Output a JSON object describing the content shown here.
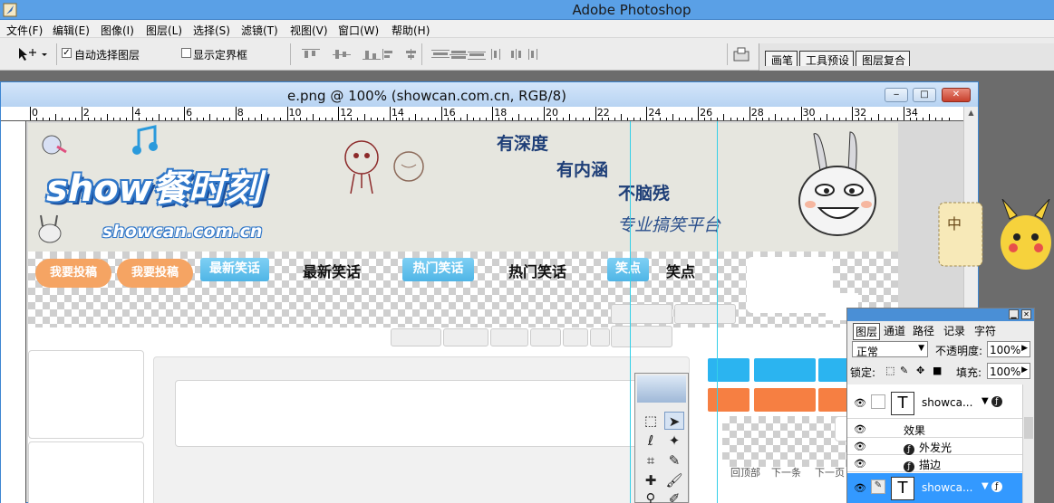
{
  "app": {
    "title": "Adobe Photoshop",
    "menus": [
      "文件(F)",
      "编辑(E)",
      "图像(I)",
      "图层(L)",
      "选择(S)",
      "滤镜(T)",
      "视图(V)",
      "窗口(W)",
      "帮助(H)"
    ]
  },
  "options": {
    "auto_select_label": "自动选择图层",
    "auto_select_checked": true,
    "show_bounds_label": "显示定界框",
    "show_bounds_checked": false
  },
  "palette_well": {
    "tabs": [
      "画笔",
      "工具预设",
      "图层复合"
    ]
  },
  "document": {
    "title": "e.png @ 100% (showcan.com.cn, RGB/8)",
    "ruler_labels": [
      "0",
      "2",
      "4",
      "6",
      "8",
      "10",
      "12",
      "14",
      "16",
      "18",
      "20",
      "22",
      "24",
      "26",
      "28",
      "30",
      "32",
      "34"
    ],
    "window_buttons": [
      "minimize",
      "restore",
      "close"
    ]
  },
  "canvas": {
    "logo_main": "show餐时刻",
    "logo_url": "showcan.com.cn",
    "slogans": [
      "有深度",
      "有内涵",
      "不脑残",
      "专业搞笑平台"
    ],
    "bubbles": [
      "我要投稿",
      "我要投稿"
    ],
    "nav_buttons": [
      "最新笑话",
      "热门笑话",
      "笑点"
    ],
    "nav_texts": [
      "最新笑话",
      "热门笑话",
      "笑点"
    ],
    "pager": [
      "回顶部",
      "下一条",
      "下一页"
    ]
  },
  "layers_panel": {
    "tabs": [
      "图层",
      "通道",
      "路径",
      "记录",
      "字符"
    ],
    "blend_mode": "正常",
    "opacity_label": "不透明度:",
    "opacity_value": "100%",
    "lock_label": "锁定:",
    "fill_label": "填充:",
    "fill_value": "100%",
    "layers": [
      {
        "name": "showca...",
        "type": "text",
        "selected": false
      },
      {
        "name": "showca...",
        "type": "text",
        "selected": true
      }
    ],
    "effects_label": "效果",
    "effects": [
      "外发光",
      "描边"
    ]
  },
  "side_widget": {
    "text": "中"
  },
  "colors": {
    "titlebar": "#5aa0e6",
    "nav_blue": "#4fb5e6",
    "bubble_orange": "#f5a463",
    "selected_layer": "#3399ff"
  }
}
